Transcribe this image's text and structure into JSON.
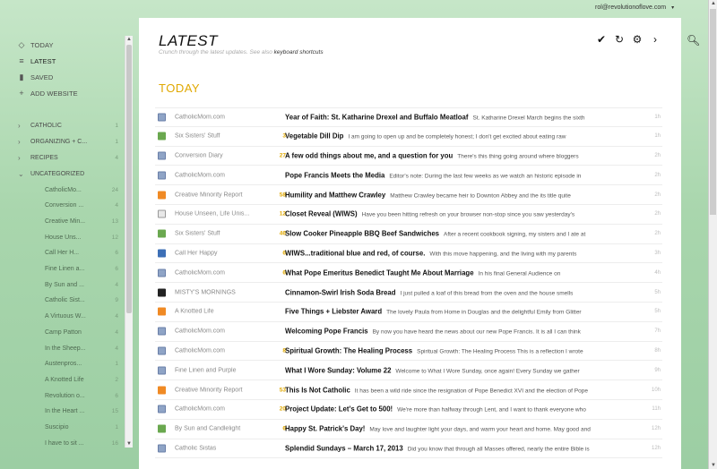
{
  "account": {
    "email": "rol@revolutionoflove.com",
    "caret": "▾"
  },
  "nav": [
    {
      "label": "TODAY",
      "icon": "◇"
    },
    {
      "label": "LATEST",
      "icon": "≡"
    },
    {
      "label": "SAVED",
      "icon": "▮"
    },
    {
      "label": "ADD WEBSITE",
      "icon": "+"
    }
  ],
  "folders": [
    {
      "label": "CATHOLIC",
      "count": "1",
      "chev": "›"
    },
    {
      "label": "ORGANIZING + C...",
      "count": "1",
      "chev": "›"
    },
    {
      "label": "RECIPES",
      "count": "4",
      "chev": "›"
    },
    {
      "label": "UNCATEGORIZED",
      "count": "",
      "chev": "⌄"
    }
  ],
  "feeds": [
    {
      "label": "CatholicMo...",
      "count": "24"
    },
    {
      "label": "Conversion ...",
      "count": "4"
    },
    {
      "label": "Creative Min...",
      "count": "13"
    },
    {
      "label": "House Uns...",
      "count": "12"
    },
    {
      "label": "Call Her H...",
      "count": "6"
    },
    {
      "label": "Fine Linen a...",
      "count": "6"
    },
    {
      "label": "By Sun and ...",
      "count": "4"
    },
    {
      "label": "Catholic Sist...",
      "count": "9"
    },
    {
      "label": "A Virtuous W...",
      "count": "4"
    },
    {
      "label": "Camp Patton",
      "count": "4"
    },
    {
      "label": "In the Sheep...",
      "count": "4"
    },
    {
      "label": "Austenpros...",
      "count": "1"
    },
    {
      "label": "A Knotted Life",
      "count": "2"
    },
    {
      "label": "Revolution o...",
      "count": "6"
    },
    {
      "label": "In the Heart ...",
      "count": "15"
    },
    {
      "label": "Suscipio",
      "count": "1"
    },
    {
      "label": "I have to sit ...",
      "count": "16"
    }
  ],
  "header": {
    "title": "LATEST",
    "subtitle": "Crunch through the latest updates. See also",
    "shortcuts_link": "keyboard shortcuts"
  },
  "tools": [
    "✔",
    "↻",
    "⚙",
    "›"
  ],
  "section_title": "TODAY",
  "search_icon": "🔍",
  "articles": [
    {
      "icon": "cm",
      "feed": "CatholicMom.com",
      "num": "",
      "title": "Year of Faith: St. Katharine Drexel and Buffalo Meatloaf",
      "snippet": "St. Katharine Drexel March begins the sixth",
      "age": "1h"
    },
    {
      "icon": "green",
      "feed": "Six Sisters' Stuff",
      "num": "3",
      "title": "Vegetable Dill Dip",
      "snippet": "I am going to open up and be completely honest; I don't get excited about eating raw",
      "age": "1h"
    },
    {
      "icon": "cm",
      "feed": "Conversion Diary",
      "num": "27",
      "title": "A few odd things about me, and a question for you",
      "snippet": "There's this thing going around where bloggers",
      "age": "2h"
    },
    {
      "icon": "cm",
      "feed": "CatholicMom.com",
      "num": "",
      "title": "Pope Francis Meets the Media",
      "snippet": "Editor's note: During the last few weeks as we watch an historic episode in",
      "age": "2h"
    },
    {
      "icon": "orange",
      "feed": "Creative Minority Report",
      "num": "58",
      "title": "Humility and Matthew Crawley",
      "snippet": "Matthew Crawley became heir to Downton Abbey and the its title quite",
      "age": "2h"
    },
    {
      "icon": "globe",
      "feed": "House Unseen, Life Unis...",
      "num": "12",
      "title": "Closet Reveal (WIWS)",
      "snippet": "Have you been hitting refresh on your browser non-stop since you saw yesterday's",
      "age": "2h"
    },
    {
      "icon": "green",
      "feed": "Six Sisters' Stuff",
      "num": "46",
      "title": "Slow Cooker Pineapple BBQ Beef Sandwiches",
      "snippet": "After a recent cookbook signing, my sisters and I ate at",
      "age": "2h"
    },
    {
      "icon": "blue",
      "feed": "Call Her Happy",
      "num": "6",
      "title": "WIWS...traditional blue and red, of course.",
      "snippet": "With this move happening, and the living with my parents",
      "age": "3h"
    },
    {
      "icon": "cm",
      "feed": "CatholicMom.com",
      "num": "6",
      "title": "What Pope Emeritus Benedict Taught Me About Marriage",
      "snippet": "In his final General Audience on",
      "age": "4h"
    },
    {
      "icon": "dark",
      "feed": "MISTY'S MORNINGS",
      "num": "",
      "title": "Cinnamon-Swirl Irish Soda Bread",
      "snippet": "I just pulled a loaf of this bread from the oven and the house smells",
      "age": "5h"
    },
    {
      "icon": "orange",
      "feed": "A Knotted Life",
      "num": "",
      "title": "Five Things + Liebster Award",
      "snippet": "The lovely Paula from Home in Douglas and the delightful Emily from Glitter",
      "age": "5h"
    },
    {
      "icon": "cm",
      "feed": "CatholicMom.com",
      "num": "",
      "title": "Welcoming Pope Francis",
      "snippet": "By now you have heard the news about our new Pope Francis. It is all I can think",
      "age": "7h"
    },
    {
      "icon": "cm",
      "feed": "CatholicMom.com",
      "num": "8",
      "title": "Spiritual Growth: The Healing Process",
      "snippet": "Spiritual Growth: The Healing Process This is a reflection I wrote",
      "age": "8h"
    },
    {
      "icon": "cm",
      "feed": "Fine Linen and Purple",
      "num": "",
      "title": "What I Wore Sunday: Volume 22",
      "snippet": "Welcome to What I Wore Sunday, once again! Every Sunday we gather",
      "age": "9h"
    },
    {
      "icon": "orange",
      "feed": "Creative Minority Report",
      "num": "53",
      "title": "This Is Not Catholic",
      "snippet": "It has been a wild ride since the resignation of Pope Benedict XVI and the election of Pope",
      "age": "10h"
    },
    {
      "icon": "cm",
      "feed": "CatholicMom.com",
      "num": "20",
      "title": "Project Update: Let's Get to 500!",
      "snippet": "We're more than halfway through Lent, and I want to thank everyone who",
      "age": "11h"
    },
    {
      "icon": "green",
      "feed": "By Sun and Candlelight",
      "num": "6",
      "title": "Happy St. Patrick's Day!",
      "snippet": "May love and laughter light your days, and warm your heart and home. May good and",
      "age": "12h"
    },
    {
      "icon": "cm",
      "feed": "Catholic Sistas",
      "num": "",
      "title": "Splendid Sundays – March 17, 2013",
      "snippet": "Did you know that through all Masses offered, nearly the entire Bible is",
      "age": "12h"
    }
  ]
}
